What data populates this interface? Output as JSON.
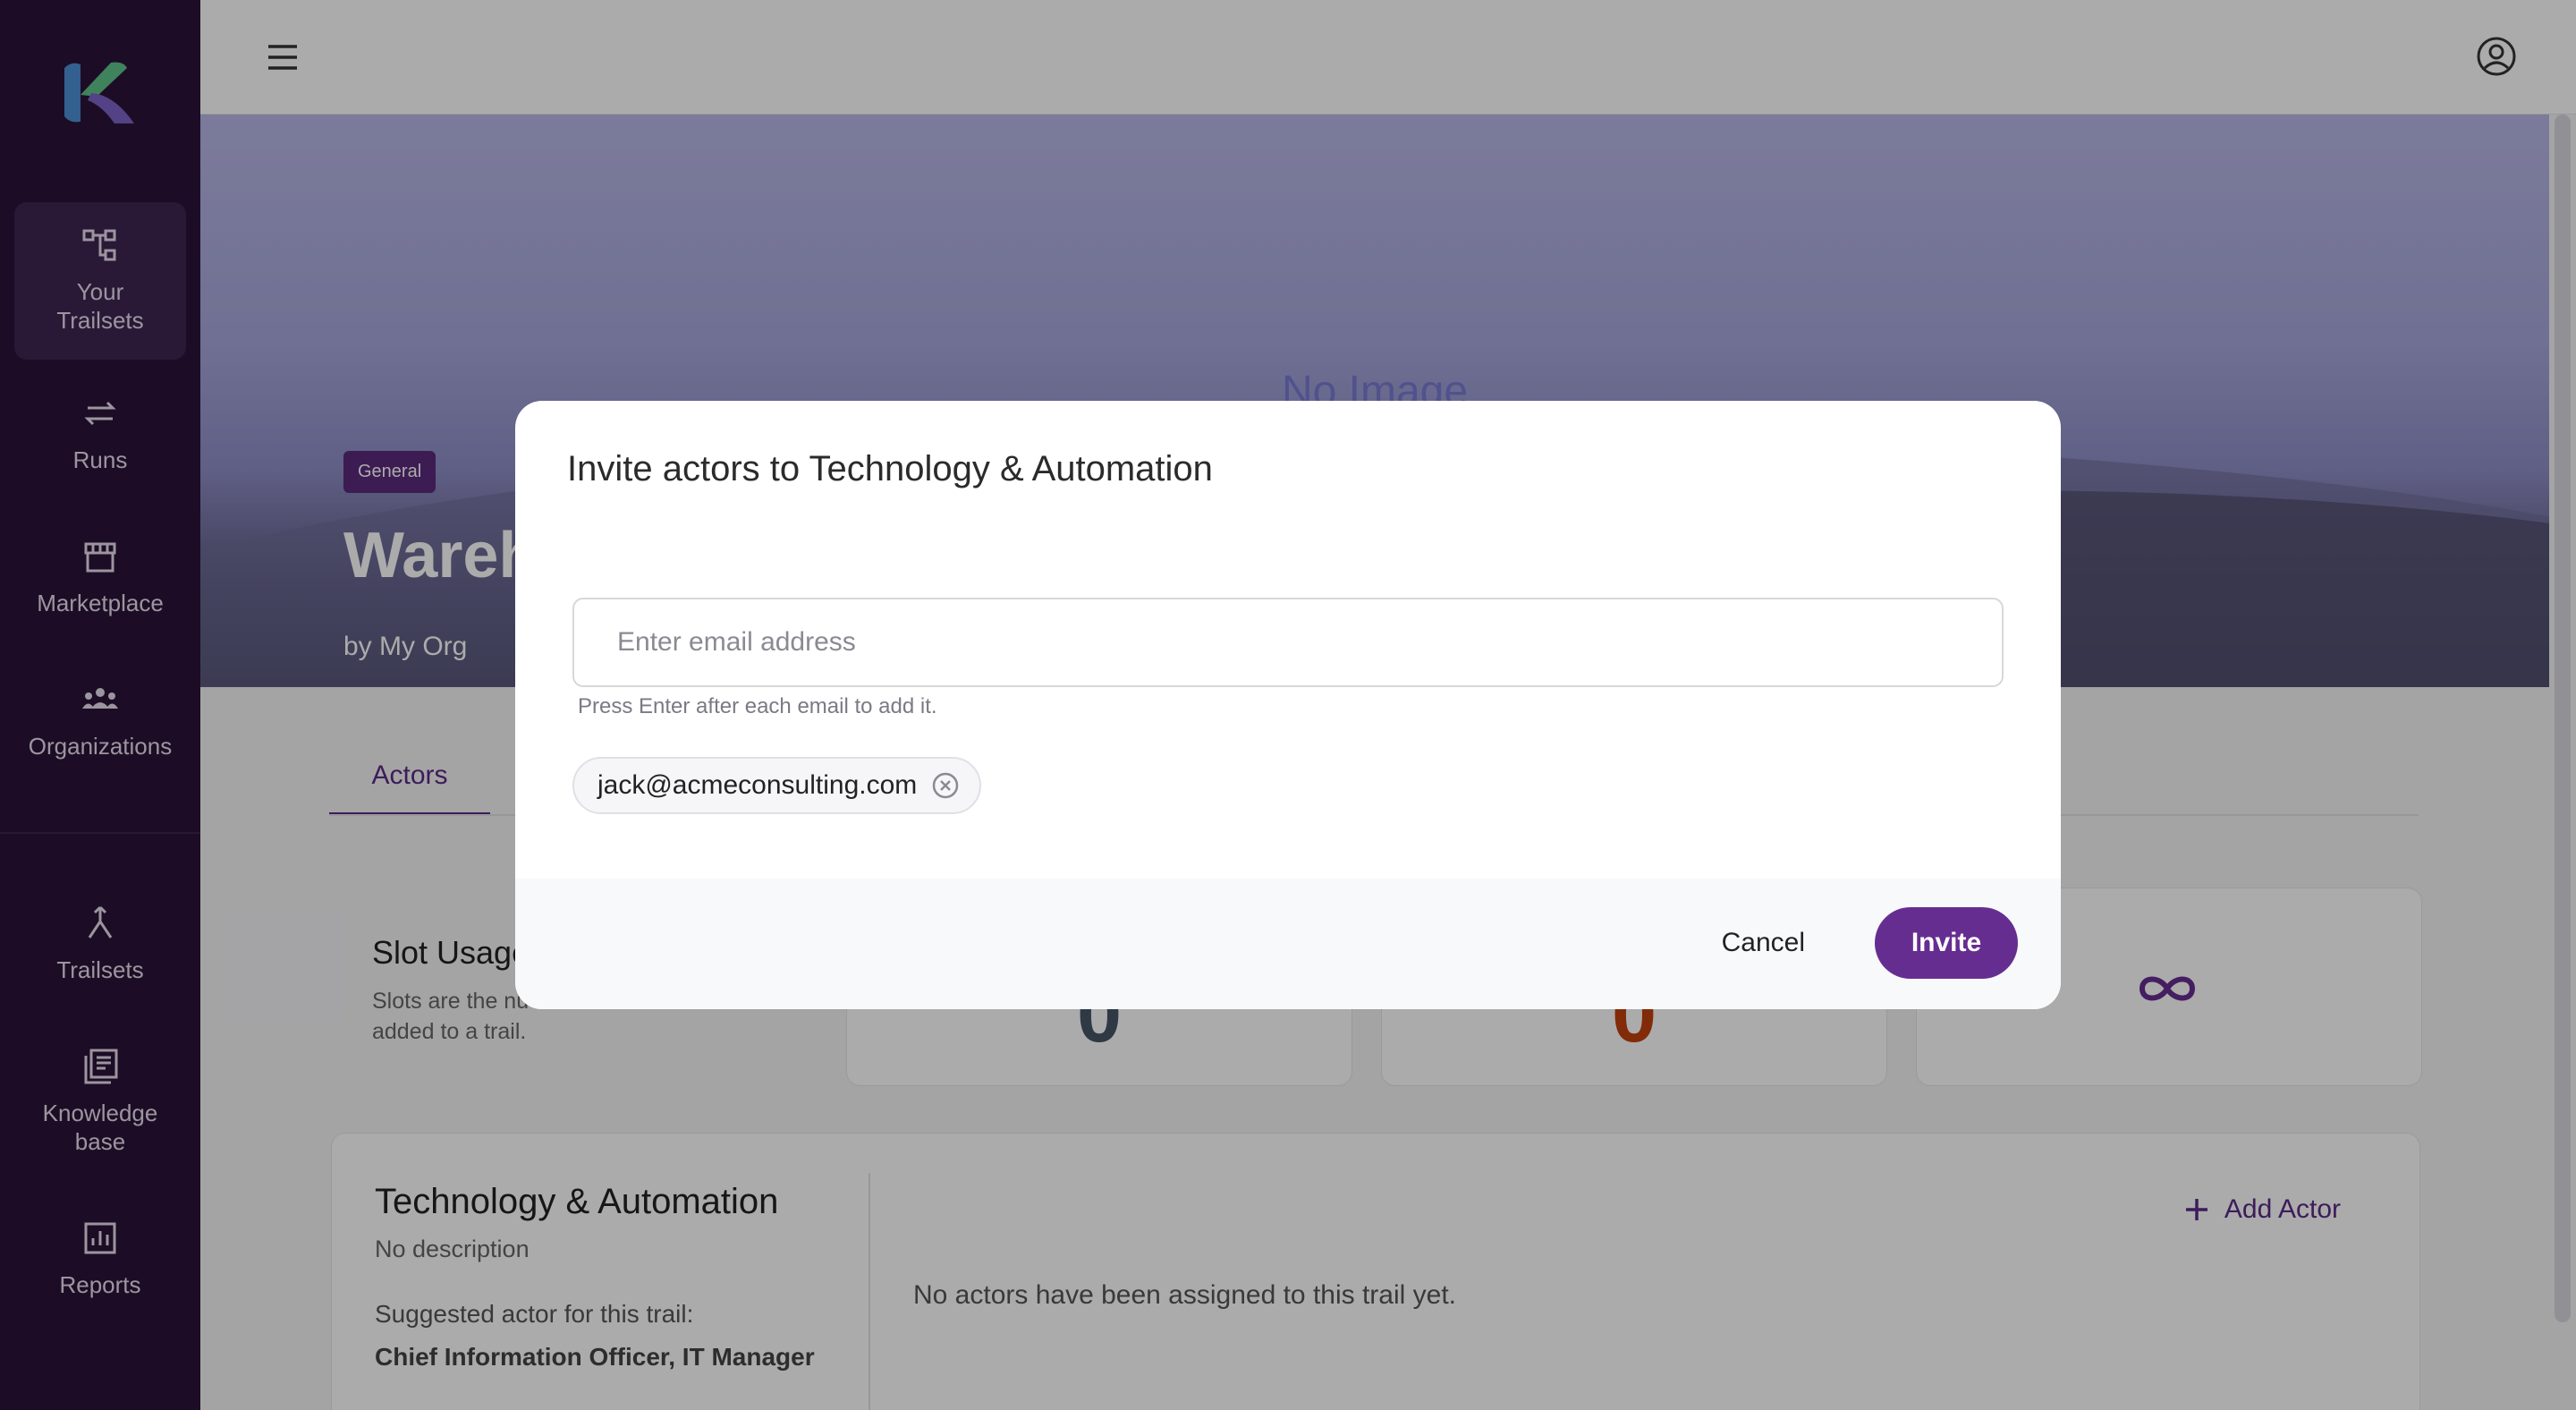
{
  "sidebar": {
    "items": [
      {
        "label": "Your\nTrailsets",
        "icon": "hierarchy-icon"
      },
      {
        "label": "Runs",
        "icon": "repeat-icon"
      },
      {
        "label": "Marketplace",
        "icon": "store-icon"
      },
      {
        "label": "Organizations",
        "icon": "group-icon"
      },
      {
        "label": "Trailsets",
        "icon": "merge-icon"
      },
      {
        "label": "Knowledge\nbase",
        "icon": "library-icon"
      },
      {
        "label": "Reports",
        "icon": "chart-icon"
      }
    ]
  },
  "hero": {
    "no_image": "No Image",
    "tag": "General",
    "title": "Wareh",
    "by": "by My Org"
  },
  "tabs": {
    "actors": "Actors"
  },
  "slots": {
    "title": "Slot Usage",
    "desc": "Slots are the nu... added to a trail.",
    "stat1": "0",
    "stat2": "0",
    "stat3_icon": "infinity-icon"
  },
  "trail": {
    "title": "Technology & Automation",
    "desc": "No description",
    "suggest_label": "Suggested actor for this trail:",
    "suggest_value": "Chief Information Officer, IT Manager",
    "add_actor": "Add Actor",
    "empty": "No actors have been assigned to this trail yet."
  },
  "modal": {
    "title": "Invite actors to Technology & Automation",
    "email_placeholder": "Enter email address",
    "hint": "Press Enter after each email to add it.",
    "chips": [
      "jack@acmeconsulting.com"
    ],
    "cancel": "Cancel",
    "invite": "Invite"
  },
  "colors": {
    "sidebar": "#2c1338",
    "accent": "#662d91",
    "stat_orange": "#c2410c",
    "stat_slate": "#475569"
  }
}
